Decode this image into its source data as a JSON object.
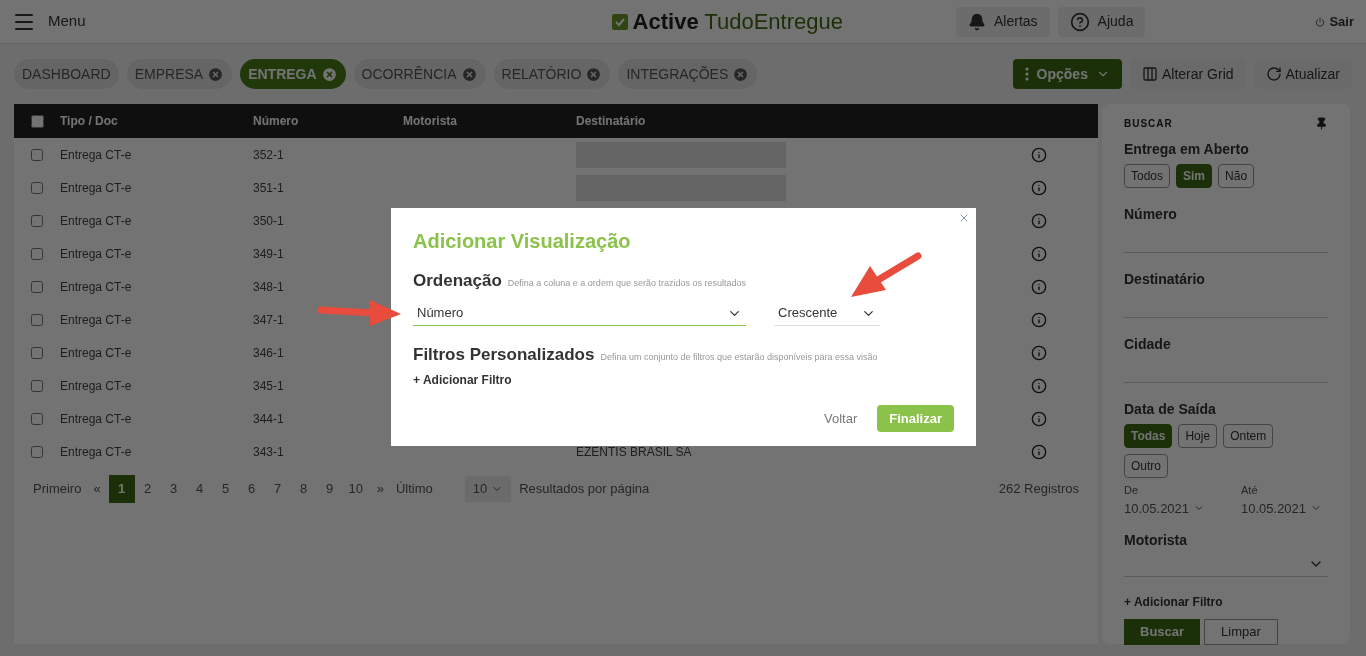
{
  "header": {
    "menu_label": "Menu",
    "brand": {
      "part_1": "Active",
      "part_2": "TudoEntregue"
    },
    "buttons": [
      {
        "kind": "bell",
        "label": "Alertas"
      },
      {
        "kind": "help",
        "label": "Ajuda"
      }
    ],
    "logout": "Sair"
  },
  "tabs": [
    {
      "label": "DASHBOARD",
      "selected": false,
      "closable": false
    },
    {
      "label": "EMPRESA",
      "selected": false,
      "closable": true
    },
    {
      "label": "ENTREGA",
      "selected": true,
      "closable": true
    },
    {
      "label": "OCORRÊNCIA",
      "selected": false,
      "closable": true
    },
    {
      "label": "RELATÓRIO",
      "selected": false,
      "closable": true
    },
    {
      "label": "INTEGRAÇÕES",
      "selected": false,
      "closable": true
    }
  ],
  "toolbar": {
    "options": "Opções",
    "grid": "Alterar Grid",
    "refresh": "Atualizar"
  },
  "table": {
    "select_all_checked": false,
    "columns": [
      "Tipo / Doc",
      "Número",
      "Motorista",
      "Destinatário"
    ],
    "rows": [
      {
        "checked": false,
        "tipo": "Entrega CT-e",
        "numero": "352-1",
        "redacted": true
      },
      {
        "checked": false,
        "tipo": "Entrega CT-e",
        "numero": "351-1",
        "redacted": true
      },
      {
        "checked": false,
        "tipo": "Entrega CT-e",
        "numero": "350-1",
        "redacted": false
      },
      {
        "checked": false,
        "tipo": "Entrega CT-e",
        "numero": "349-1",
        "redacted": false
      },
      {
        "checked": false,
        "tipo": "Entrega CT-e",
        "numero": "348-1",
        "redacted": false
      },
      {
        "checked": false,
        "tipo": "Entrega CT-e",
        "numero": "347-1",
        "redacted": false
      },
      {
        "checked": false,
        "tipo": "Entrega CT-e",
        "numero": "346-1",
        "redacted": false
      },
      {
        "checked": false,
        "tipo": "Entrega CT-e",
        "numero": "345-1",
        "redacted": false
      },
      {
        "checked": false,
        "tipo": "Entrega CT-e",
        "numero": "344-1",
        "redacted": false
      },
      {
        "checked": false,
        "tipo": "Entrega CT-e",
        "numero": "343-1",
        "redacted": false,
        "destinatario": "EZENTIS BRASIL SA"
      }
    ]
  },
  "pagination": {
    "first": "Primeiro",
    "prev": "«",
    "pages": [
      {
        "label": "1",
        "selected": true
      },
      {
        "label": "2",
        "selected": false
      },
      {
        "label": "3",
        "selected": false
      },
      {
        "label": "4",
        "selected": false
      },
      {
        "label": "5",
        "selected": false
      },
      {
        "label": "6",
        "selected": false
      },
      {
        "label": "7",
        "selected": false
      },
      {
        "label": "8",
        "selected": false
      },
      {
        "label": "9",
        "selected": false
      },
      {
        "label": "10",
        "selected": false
      }
    ],
    "next": "»",
    "last": "Último",
    "page_size": "10",
    "per_page_label": "Resultados por página",
    "total": "262 Registros"
  },
  "sidebar": {
    "title": "BUSCAR",
    "sections": [
      {
        "kind": "options",
        "label": "Entrega em Aberto",
        "options": [
          {
            "label": "Todos",
            "selected": false
          },
          {
            "label": "Sim",
            "selected": true
          },
          {
            "label": "Não",
            "selected": false
          }
        ]
      },
      {
        "kind": "field",
        "label": "Número"
      },
      {
        "kind": "field",
        "label": "Destinatário"
      },
      {
        "kind": "field",
        "label": "Cidade"
      },
      {
        "kind": "dates",
        "label": "Data de Saída",
        "options": [
          {
            "label": "Todas",
            "selected": true
          },
          {
            "label": "Hoje",
            "selected": false
          },
          {
            "label": "Ontem",
            "selected": false
          },
          {
            "label": "Outro",
            "selected": false
          }
        ],
        "from_label": "De",
        "from": "10.05.2021",
        "to_label": "Até",
        "to": "10.05.2021"
      },
      {
        "kind": "select",
        "label": "Motorista"
      }
    ],
    "add_filter": "+ Adicionar Filtro",
    "search": "Buscar",
    "clear": "Limpar"
  },
  "modal": {
    "title": "Adicionar Visualização",
    "ordering": {
      "heading": "Ordenação",
      "hint": "Defina a coluna e a ordem que serão trazidos os resultados",
      "column": "Número",
      "order": "Crescente"
    },
    "filters": {
      "heading": "Filtros Personalizados",
      "hint": "Defina um conjunto de filtros que estarão disponíveis para essa visão",
      "add": "+ Adicionar Filtro"
    },
    "back": "Voltar",
    "finish": "Finalizar"
  }
}
